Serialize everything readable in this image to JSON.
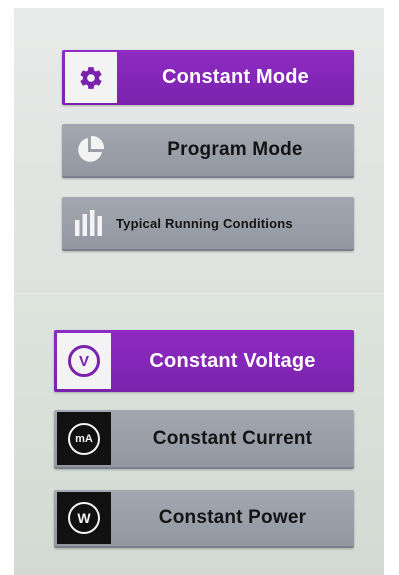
{
  "mode_menu": {
    "items": [
      {
        "label": "Constant Mode",
        "icon": "gear-icon",
        "state": "selected"
      },
      {
        "label": "Program Mode",
        "icon": "pie-chart-icon",
        "state": "normal"
      },
      {
        "label": "Typical Running Conditions",
        "icon": "bar-chart-icon",
        "state": "normal"
      }
    ]
  },
  "constant_menu": {
    "items": [
      {
        "label": "Constant Voltage",
        "icon": "voltage-icon",
        "icon_text": "V",
        "state": "selected"
      },
      {
        "label": "Constant Current",
        "icon": "current-icon",
        "icon_text": "mA",
        "state": "normal"
      },
      {
        "label": "Constant Power",
        "icon": "power-icon",
        "icon_text": "W",
        "state": "normal"
      }
    ]
  },
  "colors": {
    "selected": "#8326b8",
    "normal": "#9a9ea8",
    "icon_dark": "#111111",
    "icon_light": "#f3f3f3"
  }
}
